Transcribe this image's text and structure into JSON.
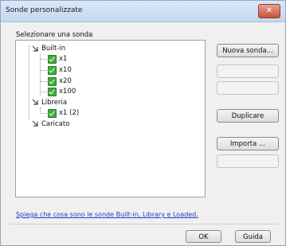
{
  "window": {
    "title": "Sonde personalizzate",
    "close_glyph": "✕"
  },
  "group_label": "Selezionare una sonda",
  "tree": {
    "builtin_label": "Built-in",
    "builtin_items": [
      "x1",
      "x10",
      "x20",
      "x100"
    ],
    "library_label": "Libreria",
    "library_items": [
      "x1 (2)"
    ],
    "loaded_label": "Caricato"
  },
  "buttons": {
    "new": "Nuova sonda...",
    "duplicate": "Duplicare",
    "import": "Importa ...",
    "ok": "OK",
    "help": "Guida"
  },
  "help_link": "Spiega che cosa sono le sonde Built-in, Library e Loaded.",
  "colors": {
    "check": "#3cae3c",
    "link": "#1a3cc8",
    "close": "#c9523c"
  }
}
